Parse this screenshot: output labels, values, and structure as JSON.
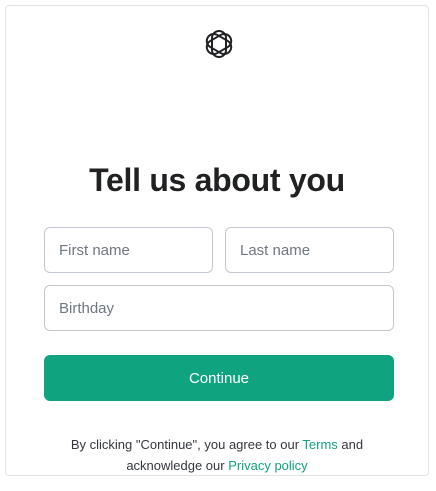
{
  "logo": {
    "icon": "openai-logo-icon"
  },
  "title": "Tell us about you",
  "form": {
    "first_name_placeholder": "First name",
    "last_name_placeholder": "Last name",
    "birthday_placeholder": "Birthday",
    "continue_label": "Continue"
  },
  "legal": {
    "prefix": "By clicking \"Continue\", you agree to our ",
    "terms_link": "Terms",
    "middle": " and",
    "line2_prefix": "acknowledge our ",
    "privacy_link": "Privacy policy"
  },
  "colors": {
    "accent": "#10a37f",
    "text": "#202123",
    "border": "#c2c8d0"
  }
}
